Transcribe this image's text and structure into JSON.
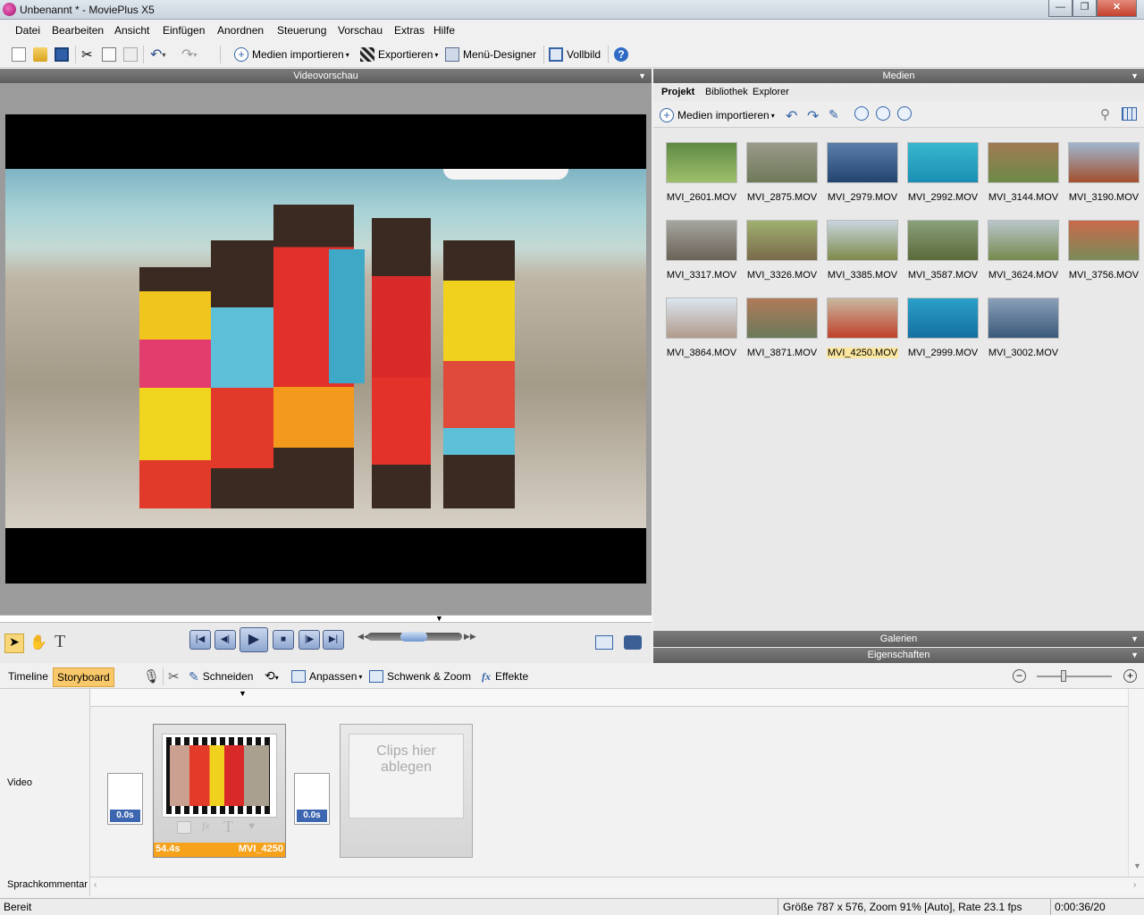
{
  "window": {
    "title": "Unbenannt * - MoviePlus X5",
    "min": "—",
    "max": "❐",
    "close": "✕"
  },
  "menu": [
    "Datei",
    "Bearbeiten",
    "Ansicht",
    "Einfügen",
    "Anordnen",
    "Steuerung",
    "Vorschau",
    "Extras",
    "Hilfe"
  ],
  "toolbar": {
    "import": "Medien importieren",
    "export": "Exportieren",
    "menu_designer": "Menü-Designer",
    "fullscreen": "Vollbild"
  },
  "preview": {
    "header": "Videovorschau"
  },
  "media": {
    "header": "Medien",
    "tabs": [
      "Projekt",
      "Bibliothek",
      "Explorer"
    ],
    "import": "Medien importieren",
    "items": [
      {
        "name": "MVI_2601.MOV",
        "c1": "#5f8a45",
        "c2": "#9dbf6a"
      },
      {
        "name": "MVI_2875.MOV",
        "c1": "#9a9a8a",
        "c2": "#6f7a58"
      },
      {
        "name": "MVI_2979.MOV",
        "c1": "#5a7fa8",
        "c2": "#23446f"
      },
      {
        "name": "MVI_2992.MOV",
        "c1": "#39b6cf",
        "c2": "#1a8fb3"
      },
      {
        "name": "MVI_3144.MOV",
        "c1": "#a07a52",
        "c2": "#6d8a48"
      },
      {
        "name": "MVI_3190.MOV",
        "c1": "#9fb6cf",
        "c2": "#a3502e"
      },
      {
        "name": "MVI_3317.MOV",
        "c1": "#a6a6a0",
        "c2": "#6a6256"
      },
      {
        "name": "MVI_3326.MOV",
        "c1": "#9fb070",
        "c2": "#7a6a4a"
      },
      {
        "name": "MVI_3385.MOV",
        "c1": "#c9d6e0",
        "c2": "#7e8a4a"
      },
      {
        "name": "MVI_3587.MOV",
        "c1": "#8aa07a",
        "c2": "#5b6a3a"
      },
      {
        "name": "MVI_3624.MOV",
        "c1": "#b9c6cc",
        "c2": "#768a4c"
      },
      {
        "name": "MVI_3756.MOV",
        "c1": "#c86a4a",
        "c2": "#7a8a5a"
      },
      {
        "name": "MVI_3864.MOV",
        "c1": "#dbe6f0",
        "c2": "#b09a8a"
      },
      {
        "name": "MVI_3871.MOV",
        "c1": "#b07a5a",
        "c2": "#6a7a5a"
      },
      {
        "name": "MVI_4250.MOV",
        "c1": "#c8b8a0",
        "c2": "#c0402a"
      },
      {
        "name": "MVI_2999.MOV",
        "c1": "#2aa0c8",
        "c2": "#1470a0"
      },
      {
        "name": "MVI_3002.MOV",
        "c1": "#8aa0b8",
        "c2": "#3a5a7a"
      }
    ],
    "selected": "MVI_4250.MOV"
  },
  "galleries": "Galerien",
  "properties": "Eigenschaften",
  "story": {
    "tabs": [
      "Timeline",
      "Storyboard"
    ],
    "cut": "Schneiden",
    "fit": "Anpassen",
    "panzoom": "Schwenk & Zoom",
    "effects": "Effekte",
    "track_video": "Video",
    "track_voice": "Sprachkommentar",
    "trans1": "0.0s",
    "trans2": "0.0s",
    "clip_duration": "54.4s",
    "clip_name": "MVI_4250",
    "drop_hint_1": "Clips hier",
    "drop_hint_2": "ablegen"
  },
  "status": {
    "left": "Bereit",
    "info": "Größe 787 x 576, Zoom 91% [Auto], Rate 23.1 fps",
    "time": "0:00:36/20"
  }
}
